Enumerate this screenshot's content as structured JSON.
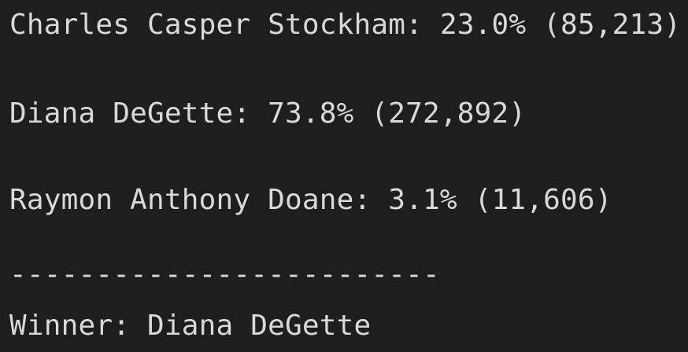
{
  "terminal": {
    "lines": [
      "Charles Casper Stockham: 23.0% (85,213)",
      "Diana DeGette: 73.8% (272,892)",
      "Raymon Anthony Doane: 3.1% (11,606)",
      "-------------------------",
      "Winner: Diana DeGette"
    ]
  }
}
